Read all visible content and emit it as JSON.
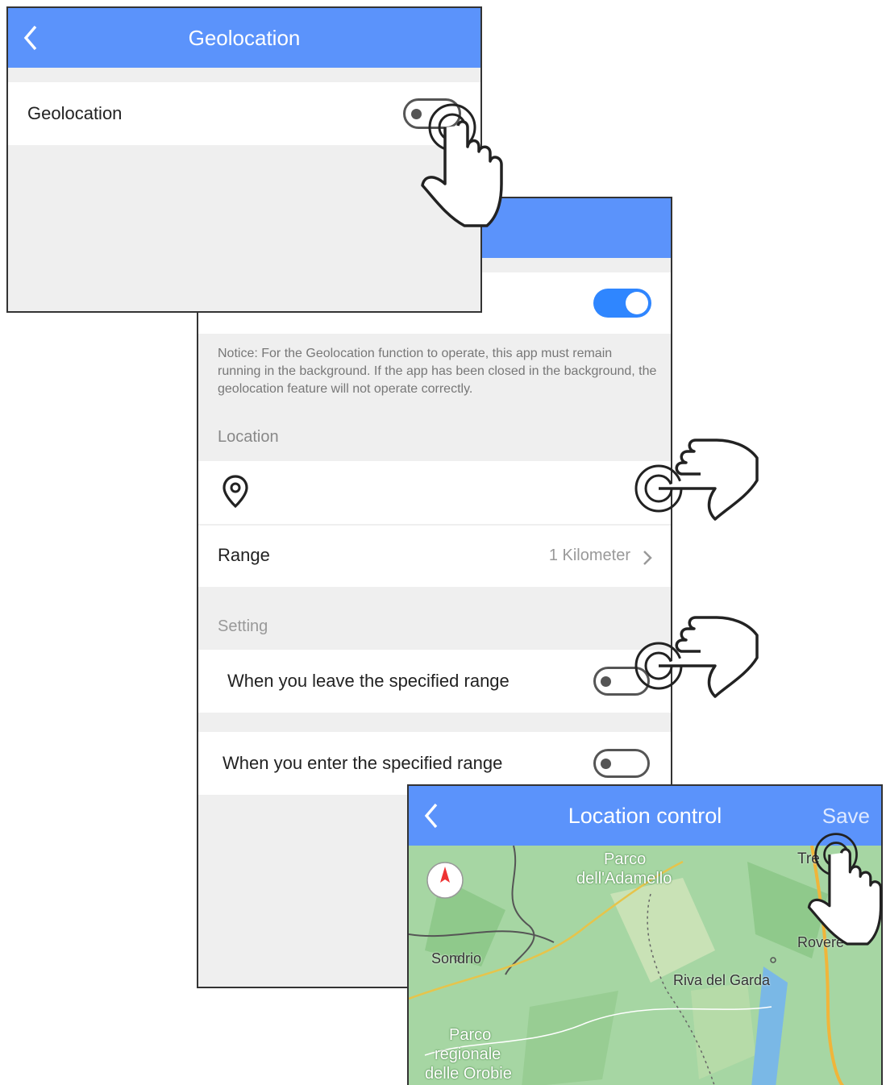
{
  "screen1": {
    "title": "Geolocation",
    "row_label": "Geolocation",
    "toggle_state": "off"
  },
  "screen2": {
    "toggle_state": "on",
    "notice": "Notice: For the Geolocation function to operate, this app must remain running in the background. If the app has been closed in the background, the geolocation feature will not operate correctly.",
    "location_header": "Location",
    "range_label": "Range",
    "range_value": "1 Kilometer",
    "setting_header": "Setting",
    "leave_label": "When you leave the specified range",
    "enter_label": "When you enter the specified range",
    "leave_toggle_state": "off",
    "enter_toggle_state": "off"
  },
  "screen3": {
    "title": "Location control",
    "save_label": "Save",
    "map_labels": {
      "adamello_1": "Parco",
      "adamello_2": "dell'Adamello",
      "sondrio": "Sondrio",
      "riva": "Riva del Garda",
      "rovereto": "Rovere",
      "trento": "Tre",
      "orobie_1": "Parco",
      "orobie_2": "regionale",
      "orobie_3": "delle Orobie"
    }
  },
  "colors": {
    "header_blue": "#5b93fb",
    "toggle_on": "#2f86ff",
    "background_gray": "#efefef",
    "map_green": "#9fd19b"
  },
  "icons": [
    "back-chevron-icon",
    "location-pin-icon",
    "chevron-right-icon",
    "compass-icon",
    "hand-pointer-icon"
  ]
}
